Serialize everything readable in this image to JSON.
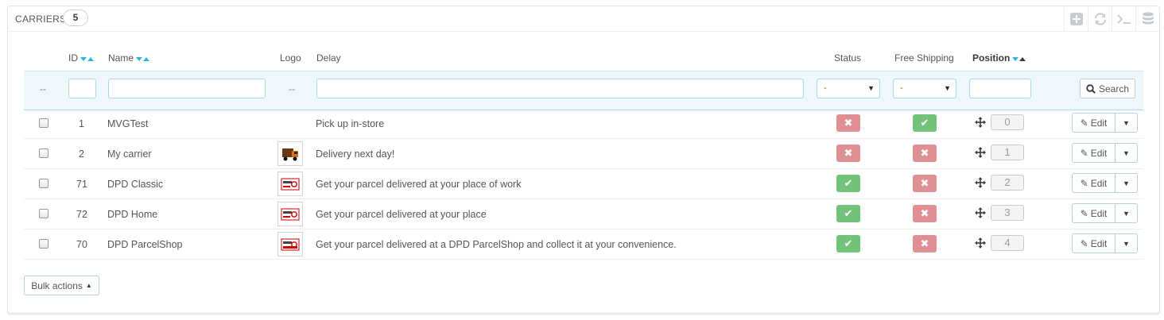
{
  "panel": {
    "title": "CARRIERS",
    "count": "5"
  },
  "toolbar": {
    "icons": [
      "add-icon",
      "refresh-icon",
      "sql-terminal-icon",
      "export-database-icon"
    ]
  },
  "columns": {
    "id": "ID",
    "name": "Name",
    "logo": "Logo",
    "delay": "Delay",
    "status": "Status",
    "free_shipping": "Free Shipping",
    "position": "Position"
  },
  "filters": {
    "checkbox_placeholder": "--",
    "logo_placeholder": "--",
    "status_select": "-",
    "free_shipping_select": "-",
    "search_label": "Search"
  },
  "rows": [
    {
      "id": "1",
      "name": "MVGTest",
      "logo": "",
      "delay": "Pick up in-store",
      "status": "no",
      "free_shipping": "yes",
      "position": "0",
      "edit": "Edit"
    },
    {
      "id": "2",
      "name": "My carrier",
      "logo": "truck-logo",
      "delay": "Delivery next day!",
      "status": "no",
      "free_shipping": "no",
      "position": "1",
      "edit": "Edit"
    },
    {
      "id": "71",
      "name": "DPD Classic",
      "logo": "dpd-logo",
      "delay": "Get your parcel delivered at your place of work",
      "status": "yes",
      "free_shipping": "no",
      "position": "2",
      "edit": "Edit"
    },
    {
      "id": "72",
      "name": "DPD Home",
      "logo": "dpd-logo",
      "delay": "Get your parcel delivered at your place",
      "status": "yes",
      "free_shipping": "no",
      "position": "3",
      "edit": "Edit"
    },
    {
      "id": "70",
      "name": "DPD ParcelShop",
      "logo": "dpd-logo",
      "delay": "Get your parcel delivered at a DPD ParcelShop and collect it at your convenience.",
      "status": "yes",
      "free_shipping": "no",
      "position": "4",
      "edit": "Edit"
    }
  ],
  "bulk_actions": "Bulk actions",
  "colors": {
    "accent": "#25b9d7",
    "enabled": "#72c279",
    "disabled": "#e08f95"
  }
}
